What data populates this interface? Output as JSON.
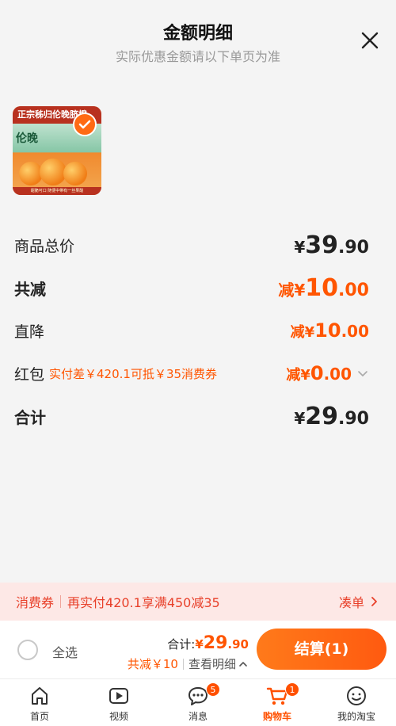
{
  "sheet": {
    "title": "金额明细",
    "subtitle": "实际优惠金额请以下单页为准"
  },
  "product": {
    "banner": "正宗秭归伦晚脐橙",
    "tag": "伦晚",
    "footer": "甜脆可口 随便中带有一丝果酸"
  },
  "rows": {
    "total": {
      "label": "商品总价",
      "currency": "¥",
      "int": "39",
      "dec": ".90"
    },
    "reduce": {
      "label": "共减",
      "prefix": "减",
      "currency": "¥",
      "int": "10",
      "dec": ".00"
    },
    "direct": {
      "label": "直降",
      "prefix": "减",
      "currency": "¥",
      "int": "10",
      "dec": ".00"
    },
    "redpacket": {
      "label": "红包",
      "note": "实付差￥420.1可抵￥35消费券",
      "prefix": "减",
      "currency": "¥",
      "int": "0",
      "dec": ".00"
    },
    "sum": {
      "label": "合计",
      "currency": "¥",
      "int": "29",
      "dec": ".90"
    }
  },
  "coupon": {
    "tag": "消费券",
    "text": "再实付420.1享满450减35",
    "link": "凑单"
  },
  "checkout": {
    "select_all": "全选",
    "sum_label": "合计:",
    "sum_currency": "¥",
    "sum_int": "29",
    "sum_dec": ".90",
    "saved": "共减￥10",
    "details": "查看明细",
    "pay": "结算(1)"
  },
  "tabs": [
    {
      "label": "首页",
      "icon": "home-icon"
    },
    {
      "label": "视频",
      "icon": "video-icon"
    },
    {
      "label": "消息",
      "icon": "message-icon",
      "badge": "5"
    },
    {
      "label": "购物车",
      "icon": "cart-icon",
      "badge": "1",
      "active": true
    },
    {
      "label": "我的淘宝",
      "icon": "profile-icon"
    }
  ],
  "colors": {
    "accent": "#ff5500",
    "coupon_bg": "#fde8e6",
    "coupon_text": "#e8402a"
  }
}
